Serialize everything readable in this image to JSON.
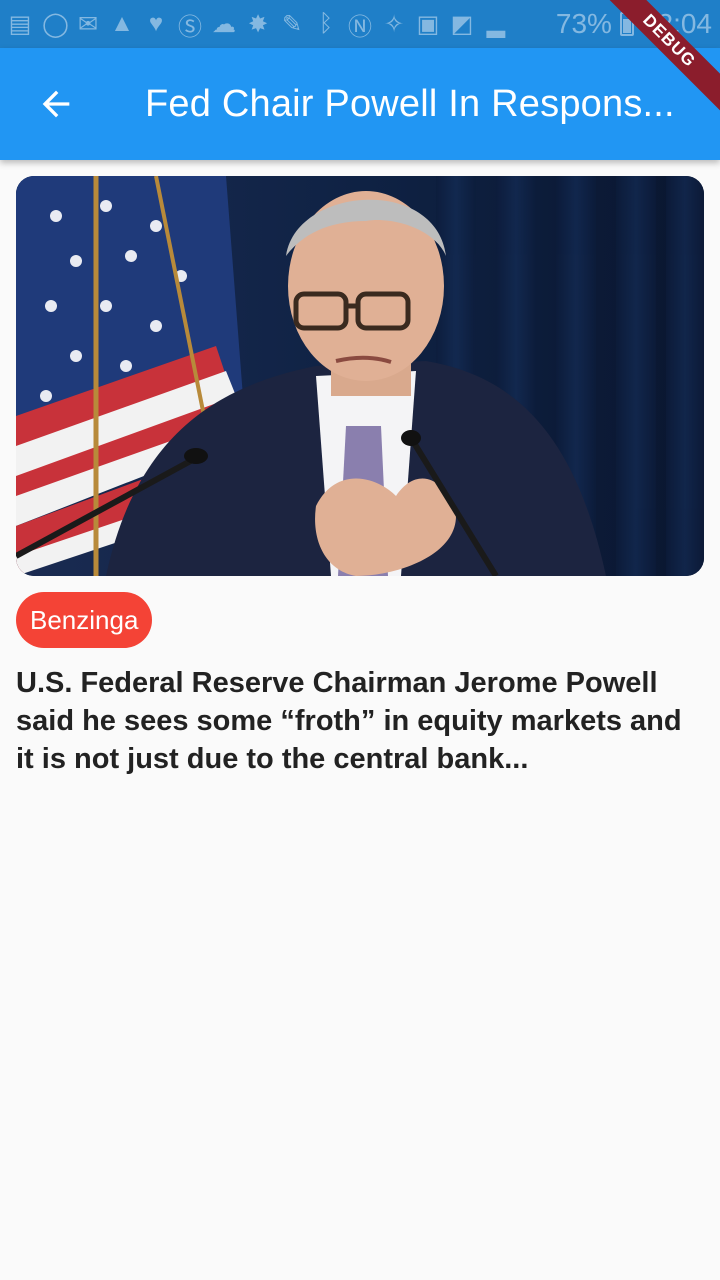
{
  "status_bar": {
    "battery_percent": "73%",
    "time": "12:04",
    "icons": [
      "sim-icon",
      "whatsapp-icon",
      "mail-icon",
      "warning-icon",
      "heart-icon",
      "s-app-icon",
      "cloud-icon",
      "chat-icon",
      "wrench-icon",
      "bluetooth-icon",
      "nfc-icon",
      "wifi-icon",
      "data-icon",
      "no-signal-icon",
      "signal-icon",
      "battery-icon"
    ]
  },
  "debug_banner": "DEBUG",
  "app_bar": {
    "title": "Fed Chair Powell In Respons...",
    "back_icon": "arrow-back-icon",
    "color": "#2196f3"
  },
  "article": {
    "image_alt": "Jerome Powell speaking at a podium in front of an American flag",
    "source": "Benzinga",
    "source_color": "#f44336",
    "headline": "U.S. Federal Reserve Chairman Jerome Powell said he sees some “froth” in equity markets and it is not just due to the central bank..."
  }
}
